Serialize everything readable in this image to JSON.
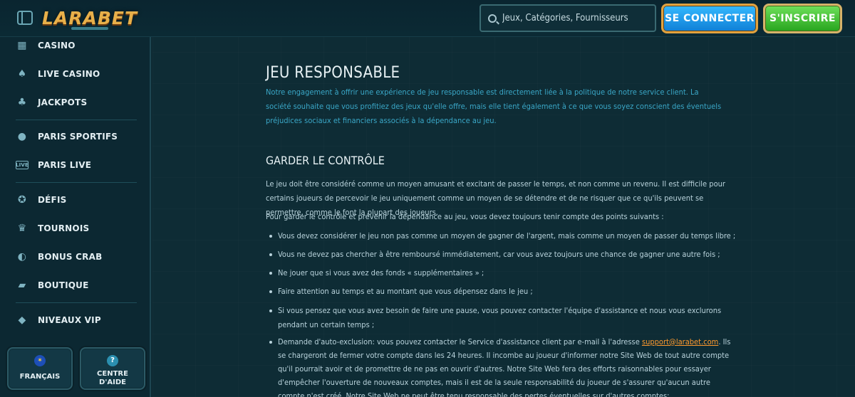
{
  "header": {
    "logo_text": "LARABET",
    "search_placeholder": "Jeux, Catégories, Fournisseurs",
    "login_label": "SE CONNECTER",
    "signup_label": "S'INSCRIRE"
  },
  "sidebar": {
    "items": [
      {
        "label": "CASINO",
        "icon": "casino-icon"
      },
      {
        "label": "LIVE CASINO",
        "icon": "card-icon"
      },
      {
        "label": "JACKPOTS",
        "icon": "clover-icon"
      },
      {
        "label": "PARIS SPORTIFS",
        "icon": "ball-icon"
      },
      {
        "label": "PARIS LIVE",
        "icon": "live-icon"
      },
      {
        "label": "DÉFIS",
        "icon": "badge-icon"
      },
      {
        "label": "TOURNOIS",
        "icon": "trophy-icon"
      },
      {
        "label": "BONUS CRAB",
        "icon": "crab-icon"
      },
      {
        "label": "BOUTIQUE",
        "icon": "basket-icon"
      },
      {
        "label": "NIVEAUX VIP",
        "icon": "diamond-icon"
      }
    ],
    "language_label": "FRANÇAIS",
    "help_label_1": "CENTRE",
    "help_label_2": "D'AIDE"
  },
  "content": {
    "title": "JEU RESPONSABLE",
    "intro": "Notre engagement à offrir une expérience de jeu responsable est directement liée à la politique de notre service client. La société souhaite que vous profitiez des jeux qu'elle offre, mais elle tient également à ce que vous soyez conscient des éventuels préjudices sociaux et financiers associés à la dépendance au jeu.",
    "section_title": "GARDER LE CONTRÔLE",
    "para1": "Le jeu doit être considéré comme un moyen amusant et excitant de passer le temps, et non comme un revenu. Il est difficile pour certains joueurs de percevoir le jeu uniquement comme un moyen de se détendre et de ne risquer que ce qu'ils peuvent se permettre, comme le font la plupart des joueurs.",
    "para2": "Pour garder le contrôle et prévenir la dépendance au jeu, vous devez toujours tenir compte des points suivants :",
    "bullets": [
      "Vous devez considérer le jeu non pas comme un moyen de gagner de l'argent, mais comme un moyen de passer du temps libre ;",
      "Vous ne devez pas chercher à être remboursé immédiatement, car vous avez toujours une chance de gagner une autre fois ;",
      "Ne jouer que si vous avez des fonds « supplémentaires » ;",
      "Faire attention au temps et au montant que vous dépensez dans le jeu ;",
      "Si vous pensez que vous avez besoin de faire une pause, vous pouvez contacter l'équipe d'assistance et nous vous exclurons pendant un certain temps ;"
    ],
    "bullet6_before": "Demande d'auto-exclusion: vous pouvez contacter le Service d'assistance client par e-mail à l'adresse ",
    "bullet6_link": "support@larabet.com",
    "bullet6_after": ". Ils se chargeront de fermer votre compte dans les 24 heures. Il incombe au joueur d'informer notre Site Web de tout autre compte qu'il pourrait avoir et de promettre de ne pas en ouvrir d'autres. Notre Site Web fera des efforts raisonnables pour essayer d'empêcher l'ouverture de nouveaux comptes, mais il est de la seule responsabilité du joueur de s'assurer qu'aucun autre compte n'est créé. Notre Site Web ne peut être tenu responsable des pertes éventuelles sur d'autres comptes;"
  }
}
